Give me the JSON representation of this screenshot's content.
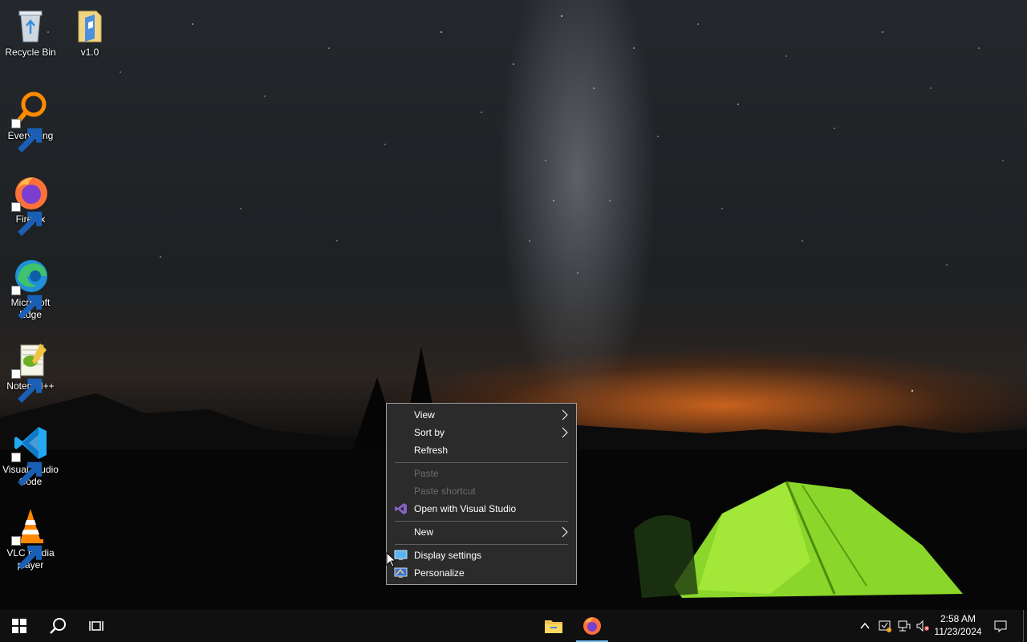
{
  "desktop": {
    "icons": [
      {
        "label": "Recycle Bin",
        "icon": "recycle-bin-icon"
      },
      {
        "label": "v1.0",
        "icon": "folder-icon"
      },
      {
        "label": "Everything",
        "icon": "everything-icon"
      },
      {
        "label": "Firefox",
        "icon": "firefox-icon"
      },
      {
        "label": "Microsoft Edge",
        "icon": "edge-icon"
      },
      {
        "label": "Notepad++",
        "icon": "notepadpp-icon"
      },
      {
        "label": "Visual Studio Code",
        "icon": "vscode-icon"
      },
      {
        "label": "VLC media player",
        "icon": "vlc-icon"
      }
    ]
  },
  "context_menu": {
    "items": [
      {
        "label": "View",
        "submenu": true,
        "enabled": true
      },
      {
        "label": "Sort by",
        "submenu": true,
        "enabled": true
      },
      {
        "label": "Refresh",
        "enabled": true
      },
      {
        "label": "Paste",
        "enabled": false
      },
      {
        "label": "Paste shortcut",
        "enabled": false
      },
      {
        "label": "Open with Visual Studio",
        "icon": "visual-studio-icon",
        "enabled": true
      },
      {
        "label": "New",
        "submenu": true,
        "enabled": true
      },
      {
        "label": "Display settings",
        "icon": "display-settings-icon",
        "enabled": true
      },
      {
        "label": "Personalize",
        "icon": "personalize-icon",
        "enabled": true
      }
    ]
  },
  "taskbar": {
    "start": "windows-start-icon",
    "search": "search-icon",
    "task_view": "task-view-icon",
    "pinned": [
      "file-explorer-icon",
      "firefox-icon"
    ],
    "tray": [
      "chevron-up-icon",
      "security-warning-icon",
      "network-icon",
      "volume-muted-icon"
    ],
    "time": "2:58 AM",
    "date": "11/23/2024",
    "notifications": "action-center-icon"
  },
  "colors": {
    "menu_bg": "#2b2b2b",
    "menu_border": "#a0a0a0",
    "disabled_text": "#6d6d6d",
    "taskbar_bg": "#101010",
    "vs_purple": "#8661c5"
  }
}
